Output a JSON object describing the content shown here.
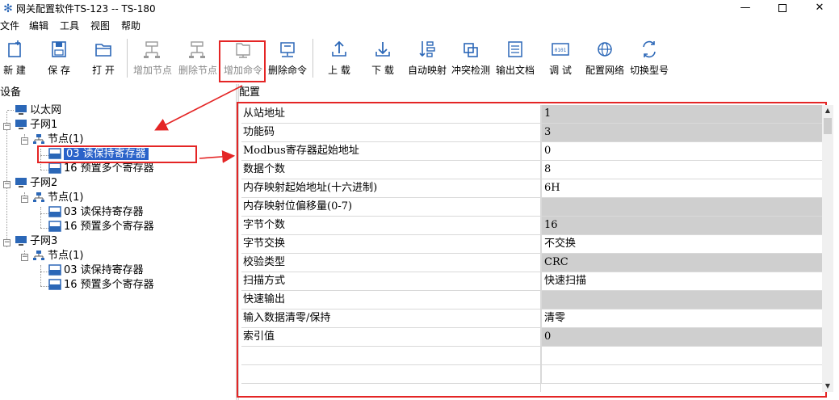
{
  "window": {
    "title": "网关配置软件TS-123  -- TS-180",
    "minimize": "—",
    "close": "✕"
  },
  "menu": [
    "文件",
    "编辑",
    "工具",
    "视图",
    "帮助"
  ],
  "toolbar": {
    "buttons": [
      {
        "label": "新 建",
        "icon": "new-file-icon",
        "enabled": true
      },
      {
        "label": "保 存",
        "icon": "save-icon",
        "enabled": true
      },
      {
        "label": "打 开",
        "icon": "open-folder-icon",
        "enabled": true
      },
      {
        "label": "增加节点",
        "icon": "add-node-icon",
        "enabled": false
      },
      {
        "label": "删除节点",
        "icon": "delete-node-icon",
        "enabled": false
      },
      {
        "label": "增加命令",
        "icon": "add-command-icon",
        "enabled": false
      },
      {
        "label": "删除命令",
        "icon": "delete-command-icon",
        "enabled": true
      },
      {
        "label": "上 载",
        "icon": "upload-icon",
        "enabled": true
      },
      {
        "label": "下 载",
        "icon": "download-icon",
        "enabled": true
      },
      {
        "label": "自动映射",
        "icon": "auto-map-icon",
        "enabled": true
      },
      {
        "label": "冲突检测",
        "icon": "conflict-check-icon",
        "enabled": true
      },
      {
        "label": "输出文档",
        "icon": "export-doc-icon",
        "enabled": true
      },
      {
        "label": "调 试",
        "icon": "debug-icon",
        "enabled": true
      },
      {
        "label": "配置网络",
        "icon": "network-config-icon",
        "enabled": true
      },
      {
        "label": "切换型号",
        "icon": "switch-model-icon",
        "enabled": true
      }
    ]
  },
  "left_panel": {
    "title": "设备"
  },
  "right_panel": {
    "title": "配置"
  },
  "tree": {
    "root": "以太网",
    "subnet1": "子网1",
    "subnet1_node": "节点(1)",
    "subnet1_cmd1": "03  读保持寄存器",
    "subnet1_cmd2": "16  预置多个寄存器",
    "subnet2": "子网2",
    "subnet2_node": "节点(1)",
    "subnet2_cmd1": "03  读保持寄存器",
    "subnet2_cmd2": "16  预置多个寄存器",
    "subnet3": "子网3",
    "subnet3_node": "节点(1)",
    "subnet3_cmd1": "03  读保持寄存器",
    "subnet3_cmd2": "16  预置多个寄存器"
  },
  "properties": [
    {
      "key": "从站地址",
      "value": "1",
      "shaded": true
    },
    {
      "key": "功能码",
      "value": "3",
      "shaded": true
    },
    {
      "key": "Modbus寄存器起始地址",
      "value": "0",
      "shaded": false
    },
    {
      "key": "数据个数",
      "value": "8",
      "shaded": false
    },
    {
      "key": "内存映射起始地址(十六进制)",
      "value": "6H",
      "shaded": false
    },
    {
      "key": "内存映射位偏移量(0-7)",
      "value": "",
      "shaded": true
    },
    {
      "key": "字节个数",
      "value": "16",
      "shaded": true
    },
    {
      "key": "字节交换",
      "value": "不交换",
      "shaded": false
    },
    {
      "key": "校验类型",
      "value": "CRC",
      "shaded": true
    },
    {
      "key": "扫描方式",
      "value": "快速扫描",
      "shaded": false
    },
    {
      "key": "快速输出",
      "value": "",
      "shaded": true
    },
    {
      "key": "输入数据清零/保持",
      "value": "清零",
      "shaded": false
    },
    {
      "key": "索引值",
      "value": "0",
      "shaded": true
    },
    {
      "key": "",
      "value": "",
      "shaded": false
    },
    {
      "key": "",
      "value": "",
      "shaded": false
    }
  ],
  "colors": {
    "highlight": "#e42525",
    "selection": "#2a62c9",
    "shaded_cell": "#cfcfcf"
  }
}
